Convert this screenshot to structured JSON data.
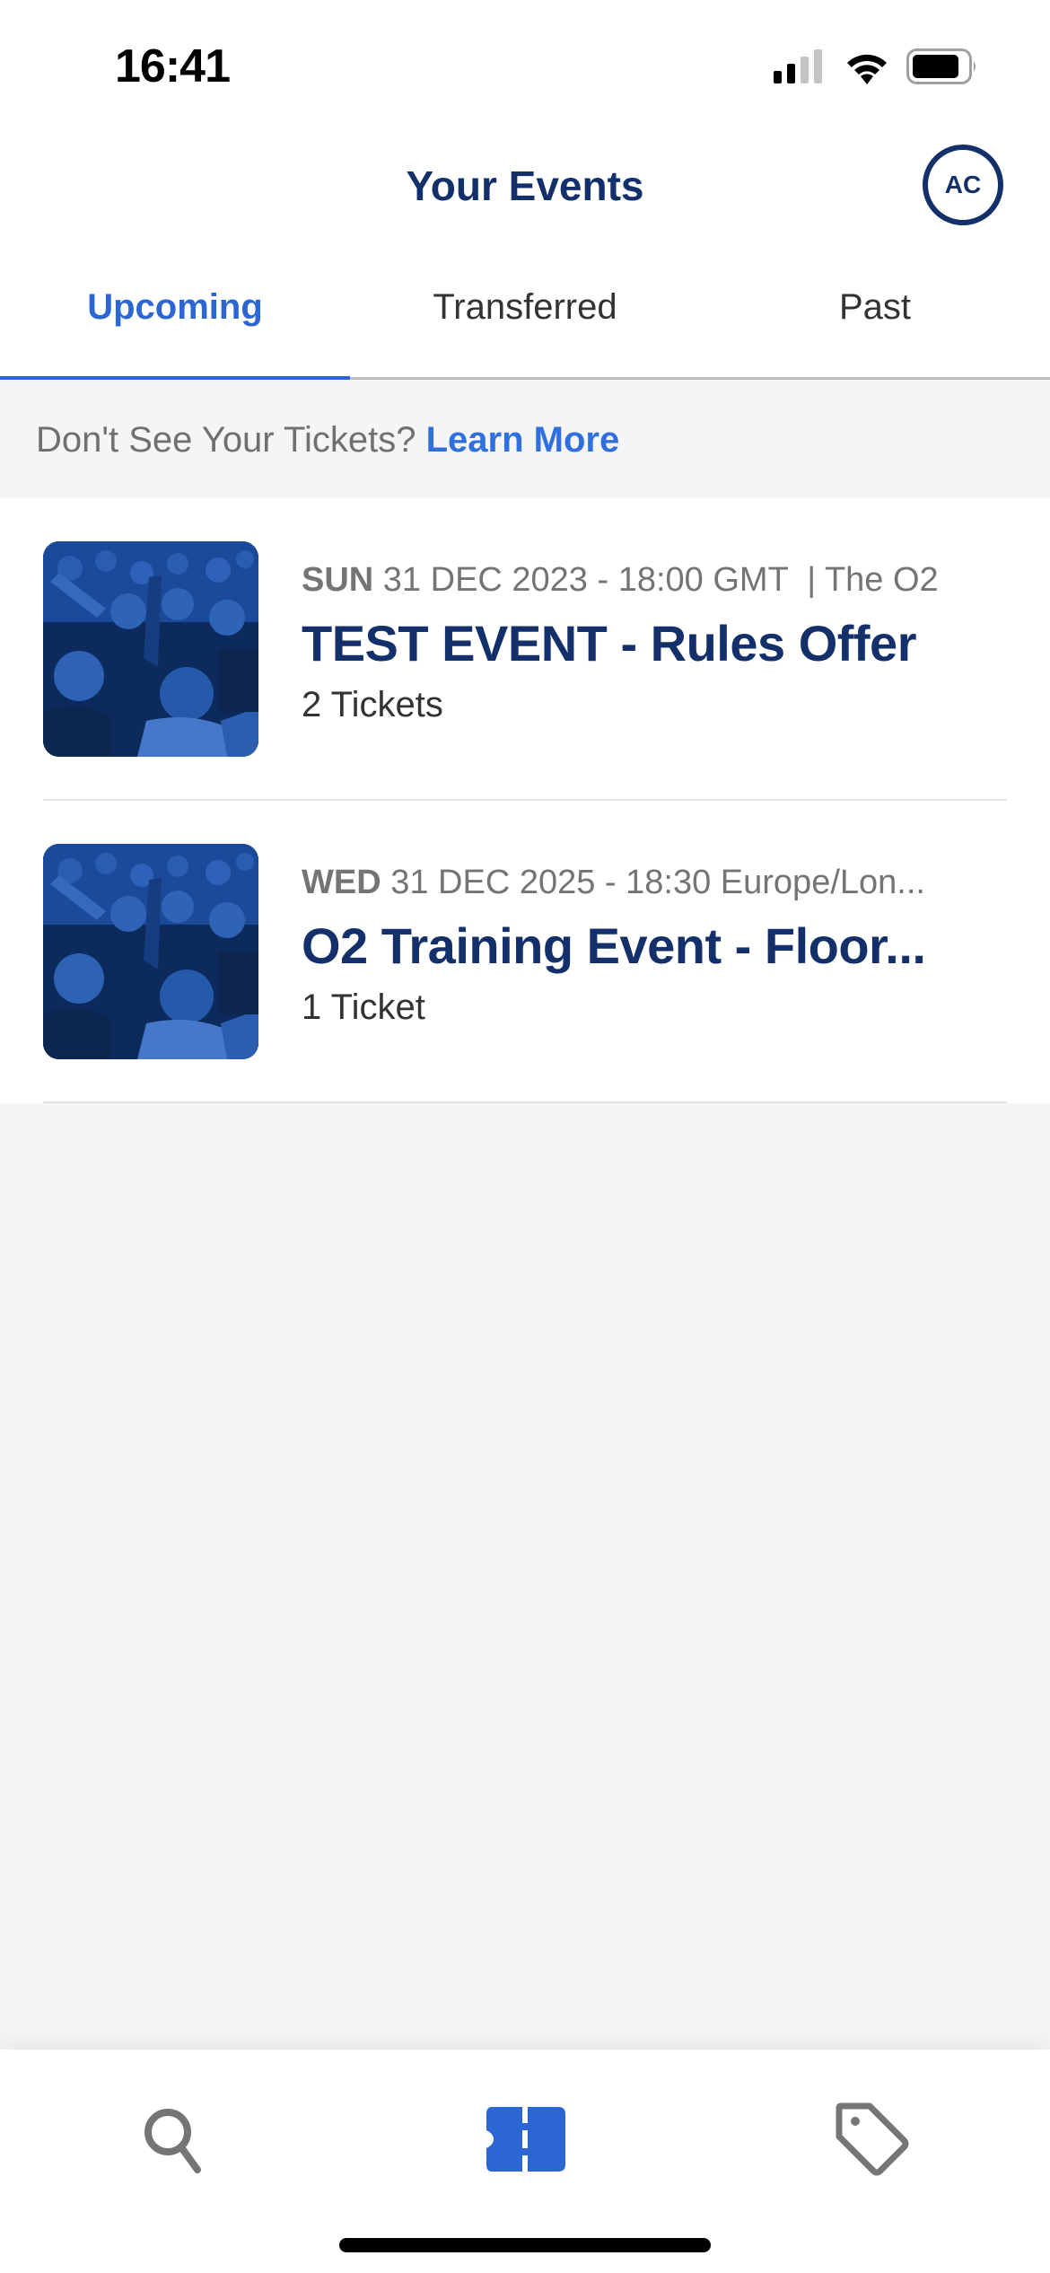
{
  "status_bar": {
    "time": "16:41",
    "signal_bars_active": 2,
    "signal_bars_total": 4,
    "battery_level_percent": 80
  },
  "header": {
    "title": "Your Events",
    "avatar_initials": "AC"
  },
  "tabs": [
    {
      "label": "Upcoming",
      "active": true
    },
    {
      "label": "Transferred",
      "active": false
    },
    {
      "label": "Past",
      "active": false
    }
  ],
  "banner": {
    "text": "Don't See Your Tickets?",
    "link_label": "Learn More"
  },
  "events": [
    {
      "day_of_week": "SUN",
      "date_detail": "31 DEC 2023 - 18:00 GMT  | The O2",
      "name": "TEST EVENT - Rules Offer",
      "tickets": "2 Tickets",
      "image": "crowd-photo"
    },
    {
      "day_of_week": "WED",
      "date_detail": "31 DEC 2025 - 18:30 Europe/Lon...",
      "name": "O2 Training Event - Floor...",
      "tickets": "1 Ticket",
      "image": "crowd-photo"
    }
  ],
  "bottom_nav": [
    {
      "icon": "search-icon",
      "label": "Search",
      "active": false
    },
    {
      "icon": "ticket-icon",
      "label": "My Events",
      "active": true
    },
    {
      "icon": "tag-icon",
      "label": "Sell",
      "active": false
    }
  ],
  "colors": {
    "brand_navy": "#13306a",
    "accent_blue": "#2b66d2",
    "link_blue": "#2f6fe0",
    "inactive_icon": "#757575",
    "background": "#f5f5f5"
  }
}
